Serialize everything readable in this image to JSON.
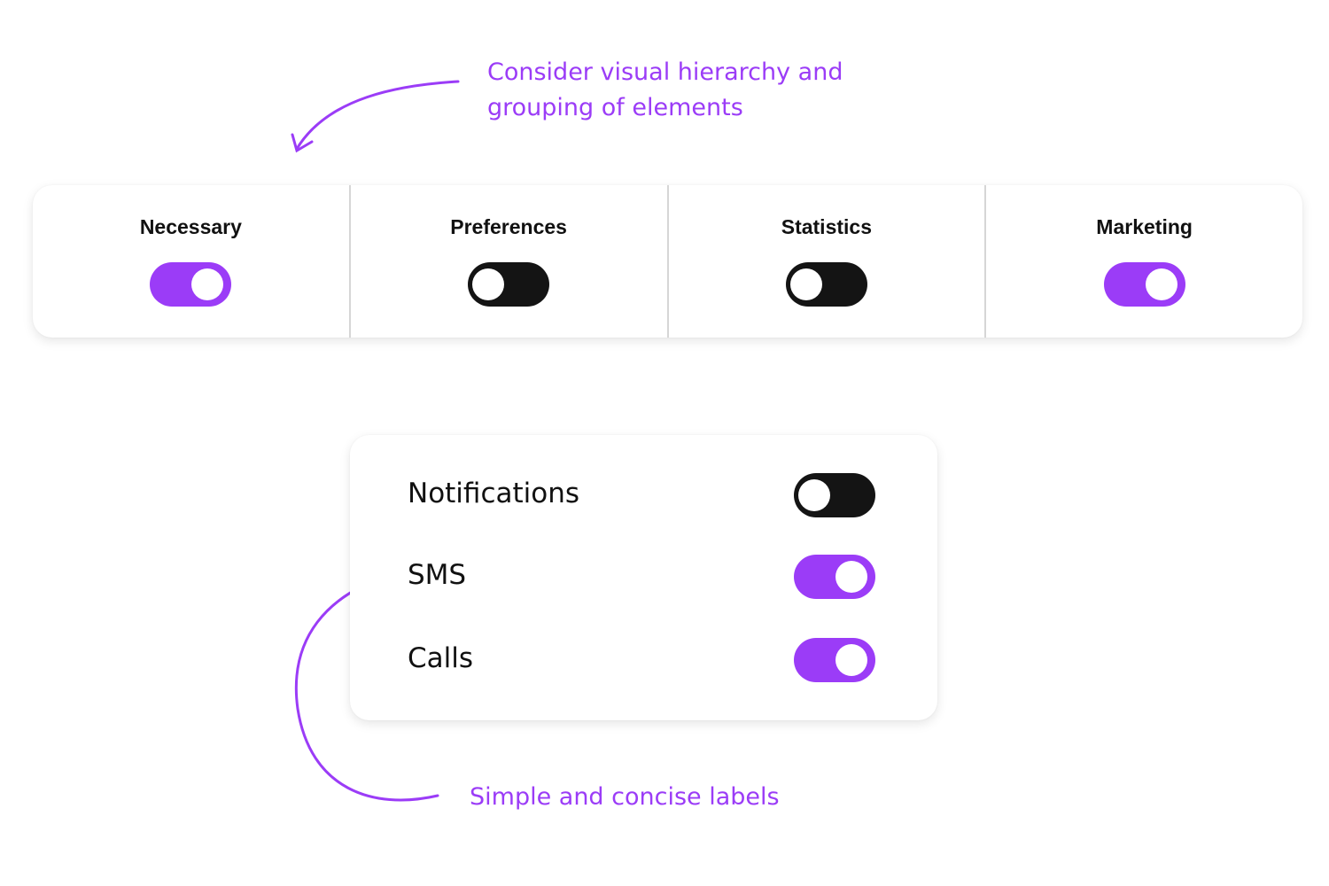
{
  "annotations": {
    "top": "Consider visual hierarchy and grouping of elements",
    "top_line1": "Consider visual hierarchy and",
    "top_line2": "grouping of elements",
    "bottom": "Simple and concise labels"
  },
  "colors": {
    "accent": "#9b3cf7",
    "toggle_off": "#141414",
    "divider": "#d6d6d6"
  },
  "cookie_categories": [
    {
      "label": "Necessary",
      "enabled": true
    },
    {
      "label": "Preferences",
      "enabled": false
    },
    {
      "label": "Statistics",
      "enabled": false
    },
    {
      "label": "Marketing",
      "enabled": true
    }
  ],
  "settings": [
    {
      "label": "Notifications",
      "enabled": false
    },
    {
      "label": "SMS",
      "enabled": true
    },
    {
      "label": "Calls",
      "enabled": true
    }
  ]
}
